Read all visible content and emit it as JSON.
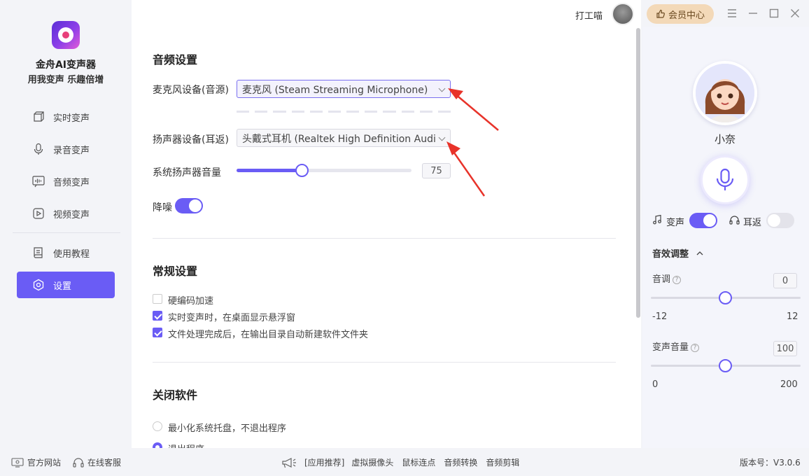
{
  "app": {
    "name": "金舟AI变声器",
    "slogan": "用我变声 乐趣倍增"
  },
  "nav": [
    {
      "label": "实时变声",
      "icon": "cube-icon"
    },
    {
      "label": "录音变声",
      "icon": "microphone-icon"
    },
    {
      "label": "音频变声",
      "icon": "audio-wave-icon"
    },
    {
      "label": "视频变声",
      "icon": "play-icon"
    },
    {
      "label": "使用教程",
      "icon": "book-icon"
    },
    {
      "label": "设置",
      "icon": "settings-icon",
      "active": true
    }
  ],
  "topbar": {
    "user_name": "打工喵",
    "vip_label": "会员中心"
  },
  "audio_settings": {
    "title": "音频设置",
    "mic_label": "麦克风设备(音源)",
    "mic_value": "麦克风 (Steam Streaming Microphone)",
    "speaker_label": "扬声器设备(耳返)",
    "speaker_value": "头戴式耳机 (Realtek High Definition Audi",
    "volume_label": "系统扬声器音量",
    "volume_value": "75",
    "volume_percent": 75,
    "noise_label": "降噪",
    "noise_on": true
  },
  "general_settings": {
    "title": "常规设置",
    "options": [
      {
        "label": "硬编码加速",
        "checked": false
      },
      {
        "label": "实时变声时，在桌面显示悬浮窗",
        "checked": true
      },
      {
        "label": "文件处理完成后，在输出目录自动新建软件文件夹",
        "checked": true
      }
    ]
  },
  "close_settings": {
    "title": "关闭软件",
    "options": [
      {
        "label": "最小化系统托盘，不退出程序",
        "checked": false
      },
      {
        "label": "退出程序",
        "checked": true
      }
    ]
  },
  "right_panel": {
    "voice_name": "小奈",
    "voice_change_label": "变声",
    "voice_change_on": true,
    "monitor_label": "耳返",
    "monitor_on": false,
    "effects_title": "音效调整",
    "pitch_label": "音调",
    "pitch_value": "0",
    "pitch_min": "-12",
    "pitch_max": "12",
    "volume_label": "变声音量",
    "volume_value": "100",
    "volume_min": "0",
    "volume_max": "200"
  },
  "footer": {
    "website": "官方网站",
    "support": "在线客服",
    "recommend": "[应用推荐]",
    "links": [
      "虚拟摄像头",
      "鼠标连点",
      "音频转换",
      "音频剪辑"
    ],
    "version": "版本号：V3.0.6"
  },
  "colors": {
    "accent": "#6a5cf5",
    "annotation_arrow": "#e8332a"
  }
}
